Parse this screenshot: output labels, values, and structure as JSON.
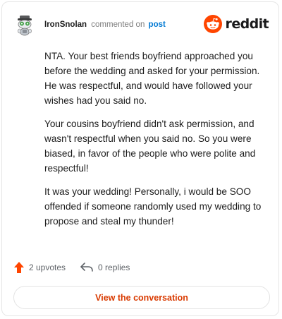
{
  "header": {
    "author": "IronSnolan",
    "action_text": "commented on",
    "post_link": "post",
    "brand": "reddit"
  },
  "comment": {
    "paragraphs": [
      "NTA. Your best friends boyfriend approached you before the wedding and asked for your permission. He was respectful, and would have followed your wishes had you said no.",
      "Your cousins boyfriend didn't ask permission, and wasn't respectful when you said no. So you were biased, in favor of the people who were polite and respectful!",
      "It was your wedding! Personally, i would be SOO offended if someone randomly used my wedding to propose and steal my thunder!"
    ]
  },
  "footer": {
    "upvotes": "2 upvotes",
    "replies": "0 replies"
  },
  "actions": {
    "view_conversation": "View the conversation"
  },
  "colors": {
    "brand_orange": "#ff4500",
    "upvote": "#ff4500",
    "link_blue": "#0079d3",
    "button_text": "#d93a00"
  },
  "icons": {
    "avatar": "snoo-avatar",
    "brand": "reddit-logo-icon",
    "upvote": "upvote-arrow-icon",
    "reply": "reply-arrow-icon"
  }
}
